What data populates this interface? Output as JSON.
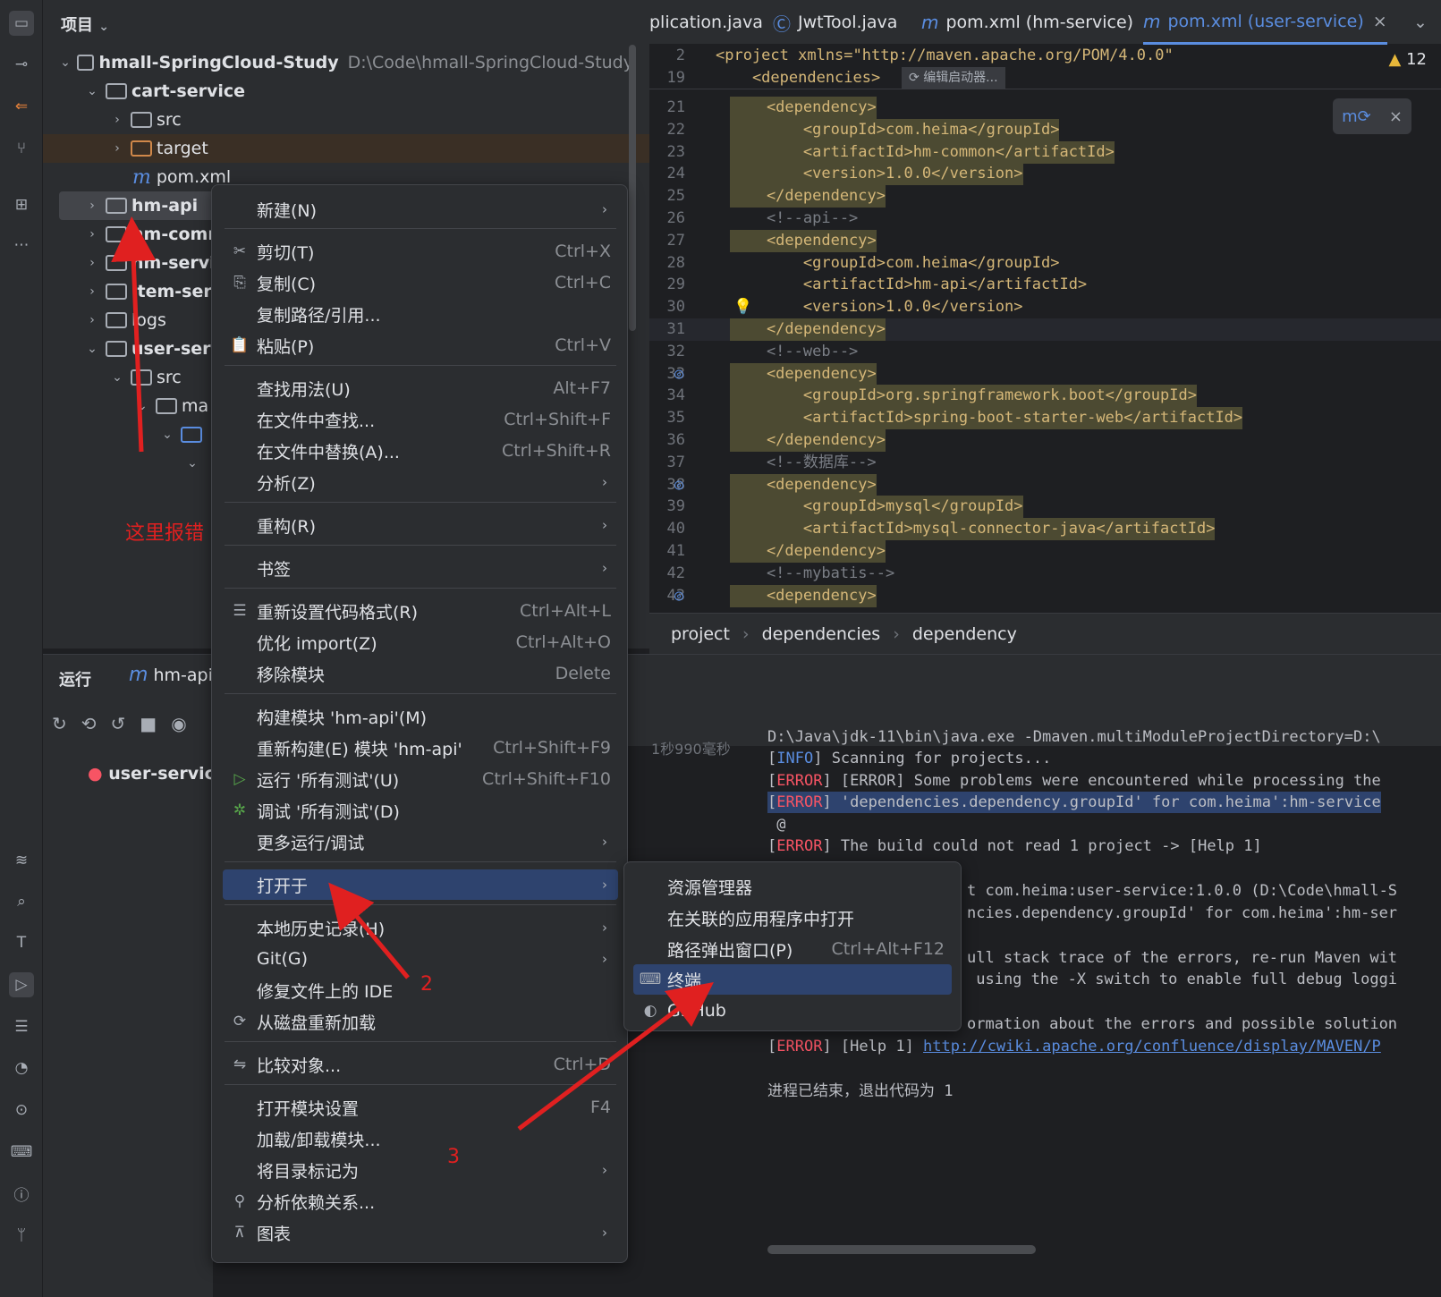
{
  "project_panel": {
    "title": "项目",
    "tree": [
      {
        "label": "hmall-SpringCloud-Study",
        "path": "D:\\Code\\hmall-SpringCloud-Study"
      },
      {
        "label": "cart-service"
      },
      {
        "label": "src"
      },
      {
        "label": "target"
      },
      {
        "label": "pom.xml"
      },
      {
        "label": "hm-api"
      },
      {
        "label": "hm-comr"
      },
      {
        "label": "hm-servi"
      },
      {
        "label": "item-serv"
      },
      {
        "label": "logs"
      },
      {
        "label": "user-serv"
      },
      {
        "label": "src"
      },
      {
        "label": "ma"
      }
    ]
  },
  "tabs": [
    {
      "label": "plication.java"
    },
    {
      "label": "JwtTool.java"
    },
    {
      "label": "pom.xml (hm-service)"
    },
    {
      "label": "pom.xml (user-service)"
    }
  ],
  "editor": {
    "warning_count": "12",
    "sticky": [
      {
        "ln": "2",
        "code": "<project xmlns=\"http://maven.apache.org/POM/4.0.0\""
      },
      {
        "ln": "19",
        "code": "    <dependencies>"
      }
    ],
    "sticky_hint": "编辑启动器...",
    "lines": [
      {
        "ln": "21",
        "code": "    <dependency>"
      },
      {
        "ln": "22",
        "code": "        <groupId>com.heima</groupId>"
      },
      {
        "ln": "23",
        "code": "        <artifactId>hm-common</artifactId>"
      },
      {
        "ln": "24",
        "code": "        <version>1.0.0</version>"
      },
      {
        "ln": "25",
        "code": "    </dependency>"
      },
      {
        "ln": "26",
        "code": "    <!--api-->"
      },
      {
        "ln": "27",
        "code": "    <dependency>"
      },
      {
        "ln": "28",
        "code": "        <groupId>com.heima</groupId>"
      },
      {
        "ln": "29",
        "code": "        <artifactId>hm-api</artifactId>"
      },
      {
        "ln": "30",
        "code": "        <version>1.0.0</version>"
      },
      {
        "ln": "31",
        "code": "    </dependency>"
      },
      {
        "ln": "32",
        "code": "    <!--web-->"
      },
      {
        "ln": "33",
        "code": "    <dependency>"
      },
      {
        "ln": "34",
        "code": "        <groupId>org.springframework.boot</groupId>"
      },
      {
        "ln": "35",
        "code": "        <artifactId>spring-boot-starter-web</artifactId>"
      },
      {
        "ln": "36",
        "code": "    </dependency>"
      },
      {
        "ln": "37",
        "code": "    <!--数据库-->"
      },
      {
        "ln": "38",
        "code": "    <dependency>"
      },
      {
        "ln": "39",
        "code": "        <groupId>mysql</groupId>"
      },
      {
        "ln": "40",
        "code": "        <artifactId>mysql-connector-java</artifactId>"
      },
      {
        "ln": "41",
        "code": "    </dependency>"
      },
      {
        "ln": "42",
        "code": "    <!--mybatis-->"
      },
      {
        "ln": "43",
        "code": "    <dependency>"
      }
    ],
    "breadcrumb": [
      "project",
      "dependencies",
      "dependency"
    ]
  },
  "run_panel": {
    "title": "运行",
    "tab": "hm-api",
    "tree_item": "user-service",
    "duration": "1秒990毫秒",
    "console": [
      {
        "prefix": "",
        "text": "D:\\Java\\jdk-11\\bin\\java.exe -Dmaven.multiModuleProjectDirectory=D:\\"
      },
      {
        "prefix": "INFO",
        "text": " Scanning for projects..."
      },
      {
        "prefix": "ERROR",
        "text": " [ERROR] Some problems were encountered while processing the"
      },
      {
        "prefix": "ERROR",
        "text": " 'dependencies.dependency.groupId' for com.heima':hm-service"
      },
      {
        "prefix": "",
        "text": " @"
      },
      {
        "prefix": "ERROR",
        "text": " The build could not read 1 project -> [Help 1]"
      },
      {
        "prefix": "",
        "text": "t com.heima:user-service:1.0.0 (D:\\Code\\hmall-S"
      },
      {
        "prefix": "",
        "text": "ncies.dependency.groupId' for com.heima':hm-ser"
      },
      {
        "prefix": "",
        "text": "ull stack trace of the errors, re-run Maven wit"
      },
      {
        "prefix": "",
        "text": " using the -X switch to enable full debug loggi"
      },
      {
        "prefix": "",
        "text": "ormation about the errors and possible solution"
      },
      {
        "prefix": "ERROR",
        "text": " [Help 1] "
      },
      {
        "prefix": "",
        "text": "进程已结束，退出代码为 1"
      }
    ],
    "help_link": "http://cwiki.apache.org/confluence/display/MAVEN/P"
  },
  "context_menu": {
    "items": [
      {
        "label": "新建(N)",
        "shortcut": "",
        "submenu": true
      },
      {
        "label": "剪切(T)",
        "shortcut": "Ctrl+X"
      },
      {
        "label": "复制(C)",
        "shortcut": "Ctrl+C"
      },
      {
        "label": "复制路径/引用...",
        "shortcut": ""
      },
      {
        "label": "粘贴(P)",
        "shortcut": "Ctrl+V"
      },
      {
        "label": "查找用法(U)",
        "shortcut": "Alt+F7"
      },
      {
        "label": "在文件中查找...",
        "shortcut": "Ctrl+Shift+F"
      },
      {
        "label": "在文件中替换(A)...",
        "shortcut": "Ctrl+Shift+R"
      },
      {
        "label": "分析(Z)",
        "shortcut": "",
        "submenu": true
      },
      {
        "label": "重构(R)",
        "shortcut": "",
        "submenu": true
      },
      {
        "label": "书签",
        "shortcut": "",
        "submenu": true
      },
      {
        "label": "重新设置代码格式(R)",
        "shortcut": "Ctrl+Alt+L"
      },
      {
        "label": "优化 import(Z)",
        "shortcut": "Ctrl+Alt+O"
      },
      {
        "label": "移除模块",
        "shortcut": "Delete"
      },
      {
        "label": "构建模块 'hm-api'(M)",
        "shortcut": ""
      },
      {
        "label": "重新构建(E) 模块 'hm-api'",
        "shortcut": "Ctrl+Shift+F9"
      },
      {
        "label": "运行 '所有测试'(U)",
        "shortcut": "Ctrl+Shift+F10"
      },
      {
        "label": "调试 '所有测试'(D)",
        "shortcut": ""
      },
      {
        "label": "更多运行/调试",
        "shortcut": "",
        "submenu": true
      },
      {
        "label": "打开于",
        "shortcut": "",
        "submenu": true
      },
      {
        "label": "本地历史记录(H)",
        "shortcut": "",
        "submenu": true
      },
      {
        "label": "Git(G)",
        "shortcut": "",
        "submenu": true
      },
      {
        "label": "修复文件上的 IDE",
        "shortcut": ""
      },
      {
        "label": "从磁盘重新加载",
        "shortcut": ""
      },
      {
        "label": "比较对象...",
        "shortcut": "Ctrl+D"
      },
      {
        "label": "打开模块设置",
        "shortcut": "F4"
      },
      {
        "label": "加载/卸载模块...",
        "shortcut": ""
      },
      {
        "label": "将目录标记为",
        "shortcut": "",
        "submenu": true
      },
      {
        "label": "分析依赖关系...",
        "shortcut": ""
      },
      {
        "label": "图表",
        "shortcut": "",
        "submenu": true
      }
    ]
  },
  "submenu": {
    "items": [
      {
        "label": "资源管理器",
        "shortcut": ""
      },
      {
        "label": "在关联的应用程序中打开",
        "shortcut": ""
      },
      {
        "label": "路径弹出窗口(P)",
        "shortcut": "Ctrl+Alt+F12"
      },
      {
        "label": "终端",
        "shortcut": ""
      },
      {
        "label": "GitHub",
        "shortcut": ""
      }
    ]
  },
  "annotations": {
    "error_note": "这里报错",
    "step2": "2",
    "step3": "3"
  },
  "colors": {
    "accent": "#5a8de0",
    "selection": "#2e436e",
    "annotation": "#e02020",
    "error": "#f75464"
  }
}
